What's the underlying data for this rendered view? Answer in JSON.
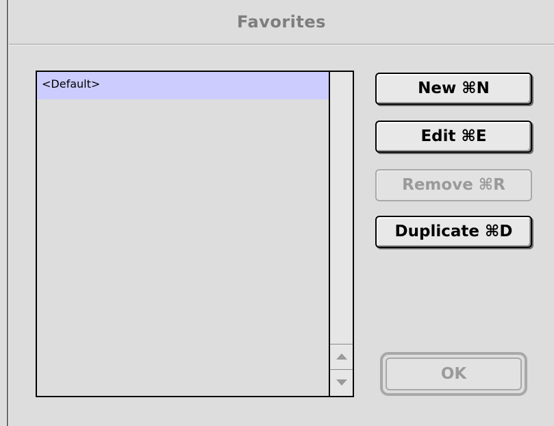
{
  "window": {
    "title": "Favorites"
  },
  "list": {
    "items": [
      {
        "label": "<Default>",
        "selected": true
      }
    ]
  },
  "buttons": {
    "new_label": "New ⌘N",
    "edit_label": "Edit ⌘E",
    "remove_label": "Remove ⌘R",
    "duplicate_label": "Duplicate ⌘D",
    "ok_label": "OK"
  },
  "colors": {
    "window_background": "#dddddd",
    "selection_highlight": "#ccccff",
    "disabled_text": "#9a9a9a"
  }
}
